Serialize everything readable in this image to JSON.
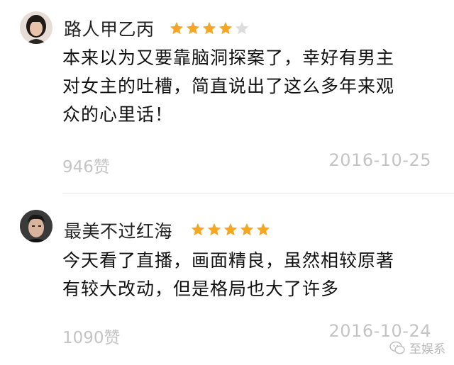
{
  "reviews": [
    {
      "username": "路人甲乙丙",
      "rating": 4,
      "rating_max": 5,
      "lines": [
        "本来以为又要靠脑洞探案了，幸好有男主",
        "对女主的吐槽，简直说出了这么多年来观",
        "众的心里话！"
      ],
      "likes": "946赞",
      "date": "2016-10-25"
    },
    {
      "username": "最美不过红海",
      "rating": 5,
      "rating_max": 5,
      "lines": [
        "今天看了直播，画面精良，虽然相较原著",
        "有较大改动，但是格局也大了许多"
      ],
      "likes": "1090赞",
      "date": "2016-10-24"
    }
  ],
  "watermark": {
    "text": "至娱系",
    "icon": "wechat-icon"
  },
  "colors": {
    "star_filled": "#f5a623",
    "star_empty": "#dcdcdc",
    "meta_text": "#c4c4c4"
  }
}
